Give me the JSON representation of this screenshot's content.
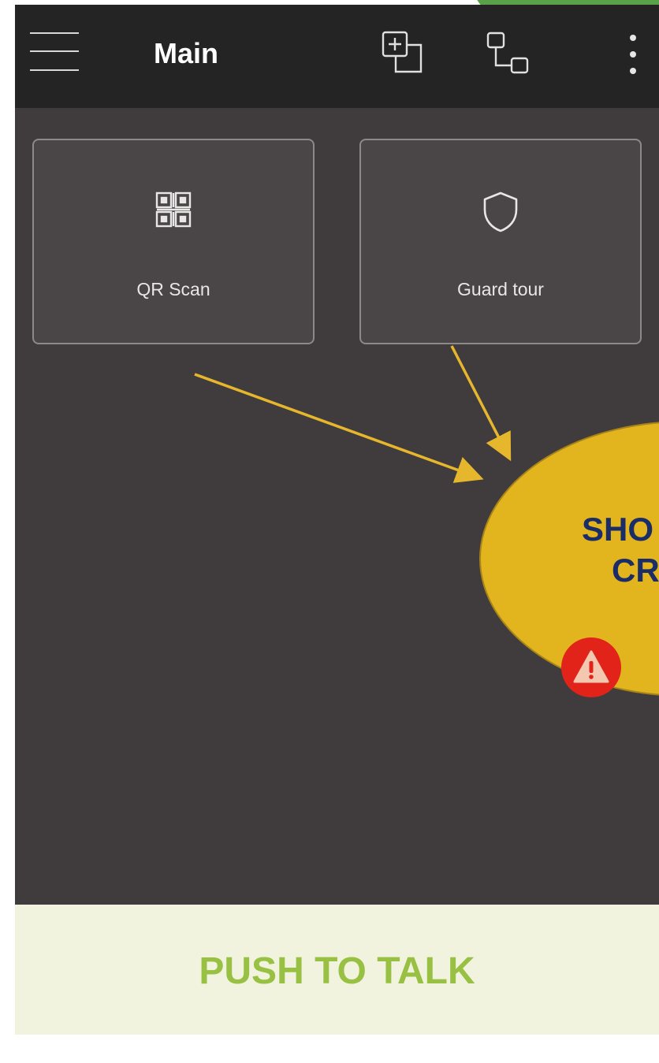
{
  "appbar": {
    "title": "Main",
    "icons": [
      "menu-icon",
      "add-window-icon",
      "multi-window-icon",
      "more-vert-icon"
    ]
  },
  "cards": [
    {
      "label": "QR Scan",
      "icon": "qr-code-icon"
    },
    {
      "label": "Guard tour",
      "icon": "shield-icon"
    }
  ],
  "callout": {
    "line1": "SHO",
    "line2": "CR",
    "color": "#e2b41e",
    "text_color": "#1a2d66"
  },
  "alert": {
    "icon": "warning-icon",
    "color": "#e2231a"
  },
  "push_to_talk": {
    "label": "PUSH TO TALK",
    "color": "#98c143"
  },
  "colors": {
    "appbar": "#252425",
    "background": "#403c3d",
    "card": "#4a4647",
    "arrow": "#e6b72d"
  }
}
